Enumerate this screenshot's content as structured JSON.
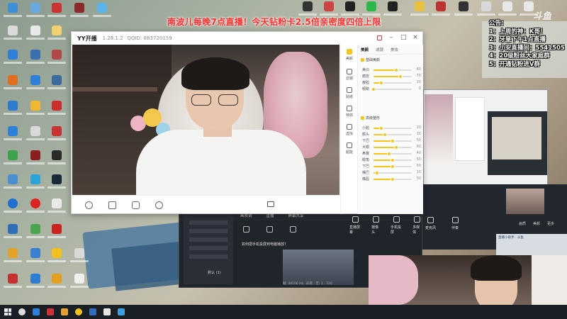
{
  "overlay": {
    "banner": "南波儿每晚7点直播！今天钻粉卡2.5倍亲密度四倍上限",
    "watermark": "斗鱼",
    "notice_title": "公告：",
    "notice_lines": [
      "1：上周的神：K哥！",
      "2：牙皇下午1点直播",
      "3：小安直播间：5541505",
      "4：20级粉丝大家庭群",
      "5：开通钻粉进V群"
    ]
  },
  "yy_window": {
    "app_name": "YY开播",
    "version": "1.28.1.2",
    "qq_id": "QQID: 883720159",
    "close_glyph": "×",
    "minimize_glyph": "–",
    "maximize_glyph": "□"
  },
  "side_tabs": [
    "美颜",
    "滤镜",
    "贴纸",
    "特效",
    "虚拟",
    "超能"
  ],
  "panel": {
    "tabs": [
      "美颜",
      "滤镜",
      "美妆"
    ],
    "section1": "基础美颜",
    "section1_rows": [
      {
        "label": "美白",
        "value": 60
      },
      {
        "label": "磨皮",
        "value": 70
      },
      {
        "label": "瘦脸",
        "value": 20
      },
      {
        "label": "眼睛",
        "value": 0
      }
    ],
    "section2": "高级整形",
    "section2_rows": [
      {
        "label": "小脸",
        "value": 20
      },
      {
        "label": "额头",
        "value": 30
      },
      {
        "label": "下巴",
        "value": 50
      },
      {
        "label": "大眼",
        "value": 60
      },
      {
        "label": "鼻翼",
        "value": 40
      },
      {
        "label": "眼角",
        "value": 50
      },
      {
        "label": "下巴",
        "value": 50
      },
      {
        "label": "嘴巴",
        "value": 10
      },
      {
        "label": "嘴唇",
        "value": 50
      }
    ]
  },
  "tool_window": {
    "tabs": [
      "画质调",
      "直播",
      "屏幕共享"
    ],
    "notice": "如何把手机投屏到电脑播放？",
    "caption": "默认 (1)",
    "status": "帧: 44100 Hz · 码率 · 音: 1 · 720",
    "buttons": [
      "直播屏幕",
      "摄像头",
      "手机投屏",
      "多媒体",
      "麦克风",
      "伴奏"
    ],
    "right_buttons": [
      "画质",
      "美颜",
      "更多"
    ]
  },
  "right_info": {
    "line1": "直播小助手 · 斗鱼"
  }
}
